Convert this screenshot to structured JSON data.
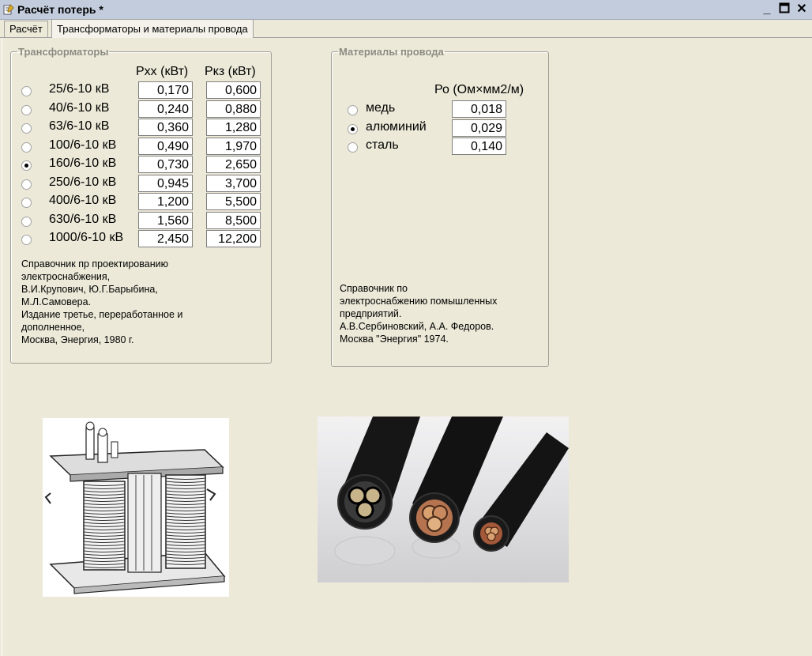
{
  "window": {
    "title": "Расчёт потерь *",
    "minimize": "_",
    "maximize": "□",
    "close": "✕"
  },
  "tabs": [
    {
      "label": "Расчёт"
    },
    {
      "label": "Трансформаторы и материалы провода"
    }
  ],
  "transformers": {
    "group_title": "Трансформаторы",
    "col_pxx": "Pxx (кВт)",
    "col_pkz": "Pкз (кВт)",
    "selected_index": 4,
    "rows": [
      {
        "label": "25/6-10 кВ",
        "pxx": "0,170",
        "pkz": "0,600"
      },
      {
        "label": "40/6-10 кВ",
        "pxx": "0,240",
        "pkz": "0,880"
      },
      {
        "label": "63/6-10 кВ",
        "pxx": "0,360",
        "pkz": "1,280"
      },
      {
        "label": "100/6-10 кВ",
        "pxx": "0,490",
        "pkz": "1,970"
      },
      {
        "label": "160/6-10 кВ",
        "pxx": "0,730",
        "pkz": "2,650"
      },
      {
        "label": "250/6-10 кВ",
        "pxx": "0,945",
        "pkz": "3,700"
      },
      {
        "label": "400/6-10 кВ",
        "pxx": "1,200",
        "pkz": "5,500"
      },
      {
        "label": "630/6-10 кВ",
        "pxx": "1,560",
        "pkz": "8,500"
      },
      {
        "label": "1000/6-10 кВ",
        "pxx": "2,450",
        "pkz": "12,200"
      }
    ],
    "reference": "Справочник пр проектированию\nэлектроснабжения,\nВ.И.Крупович, Ю.Г.Барыбина,\nМ.Л.Самовера.\nИздание третье, переработанное и\nдополненное,\nМосква, Энергия, 1980 г."
  },
  "materials": {
    "group_title": "Материалы провода",
    "col_ro": "Ро (Ом×мм2/м)",
    "selected_index": 1,
    "rows": [
      {
        "label": "медь",
        "ro": "0,018"
      },
      {
        "label": "алюминий",
        "ro": "0,029"
      },
      {
        "label": "сталь",
        "ro": "0,140"
      }
    ],
    "reference": "Справочник по\nэлектроснабжению помышленных\nпредприятий.\nА.В.Сербиновский, А.А. Федоров.\nМосква \"Энергия\" 1974."
  },
  "images": {
    "transformer": "transformer-illustration",
    "cables": "cable-cross-section-photo"
  }
}
